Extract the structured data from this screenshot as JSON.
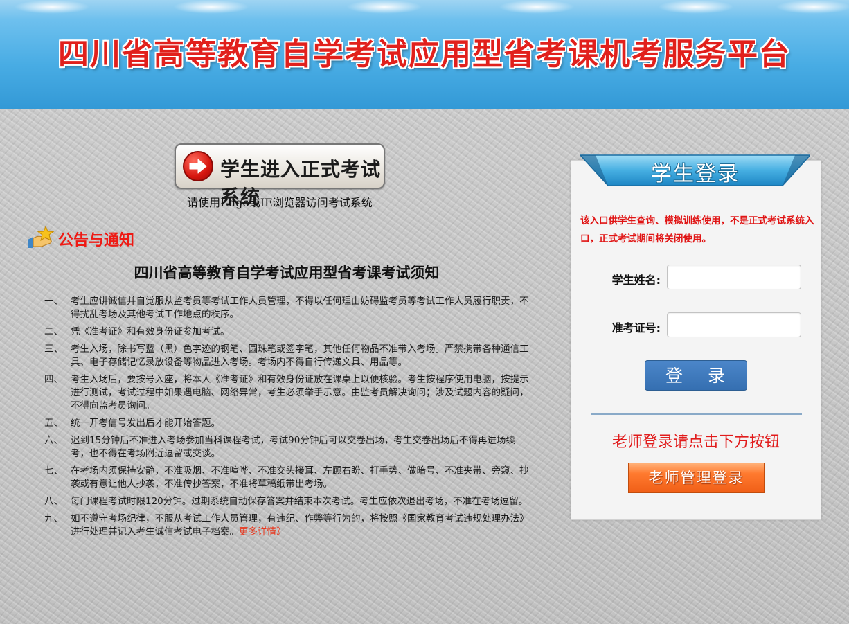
{
  "header": {
    "title": "四川省高等教育自学考试应用型省考课机考服务平台"
  },
  "enter_exam": {
    "button_label": "学生进入正式考试系统",
    "browser_hint": "请使用Edge或IE浏览器访问考试系统"
  },
  "notice": {
    "section_title": "公告与通知",
    "rules_title": "四川省高等教育自学考试应用型省考课考试须知",
    "rules": [
      {
        "num": "一、",
        "text": "考生应讲诚信并自觉服从监考员等考试工作人员管理，不得以任何理由妨碍监考员等考试工作人员履行职责，不得扰乱考场及其他考试工作地点的秩序。"
      },
      {
        "num": "二、",
        "text": "凭《准考证》和有效身份证参加考试。"
      },
      {
        "num": "三、",
        "text": "考生入场，除书写蓝（黑）色字迹的钢笔、圆珠笔或签字笔，其他任何物品不准带入考场。严禁携带各种通信工具、电子存储记忆录放设备等物品进入考场。考场内不得自行传递文具、用品等。"
      },
      {
        "num": "四、",
        "text": "考生入场后，要按号入座，将本人《准考证》和有效身份证放在课桌上以便核验。考生按程序使用电脑，按提示进行测试，考试过程中如果遇电脑、网络异常，考生必须举手示意。由监考员解决询问；涉及试题内容的疑问，不得向监考员询问。"
      },
      {
        "num": "五、",
        "text": "统一开考信号发出后才能开始答题。"
      },
      {
        "num": "六、",
        "text": "迟到15分钟后不准进入考场参加当科课程考试，考试90分钟后可以交卷出场，考生交卷出场后不得再进场续考，也不得在考场附近逗留或交谈。"
      },
      {
        "num": "七、",
        "text": "在考场内须保持安静，不准吸烟、不准喧哗、不准交头接耳、左顾右盼、打手势、做暗号、不准夹带、旁窥、抄袭或有意让他人抄袭，不准传抄答案，不准将草稿纸带出考场。"
      },
      {
        "num": "八、",
        "text": "每门课程考试时限120分钟。过期系统自动保存答案并结束本次考试。考生应依次退出考场，不准在考场逗留。"
      },
      {
        "num": "九、",
        "text": "如不遵守考场纪律，不服从考试工作人员管理，有违纪、作弊等行为的，将按照《国家教育考试违规处理办法》进行处理并记入考生诚信考试电子档案。"
      }
    ],
    "more_link": "更多详情》"
  },
  "login": {
    "title": "学生登录",
    "note": "该入口供学生查询、模拟训练使用，不是正式考试系统入口，正式考试期间将关闭使用。",
    "name_label": "学生姓名:",
    "name_value": "",
    "id_label": "准考证号:",
    "id_value": "",
    "submit_label": "登 录",
    "teacher_hint": "老师登录请点击下方按钮",
    "teacher_button": "老师管理登录"
  },
  "colors": {
    "header_blue": "#48ace4",
    "title_red": "#e1201c",
    "notice_red": "#ee1a14",
    "login_blue": "#356fb1",
    "teacher_orange": "#f05f17"
  }
}
